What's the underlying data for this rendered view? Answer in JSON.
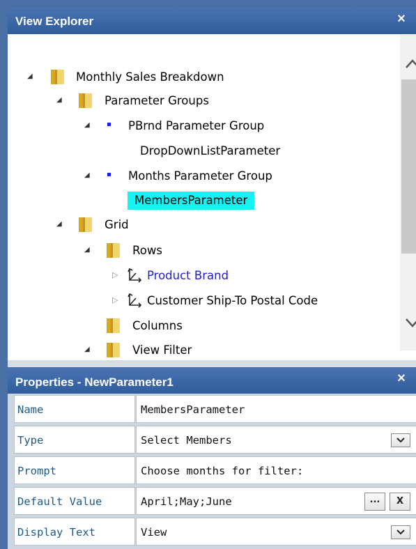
{
  "view_explorer": {
    "title": "View Explorer",
    "close": "×",
    "tree": {
      "root": "Monthly Sales Breakdown",
      "parameter_groups": "Parameter Groups",
      "pbrnd_group": "PBrnd Parameter Group",
      "dropdown_param": "DropDownListParameter",
      "months_group": "Months Parameter Group",
      "members_param": "MembersParameter",
      "grid": "Grid",
      "rows": "Rows",
      "product_brand": "Product Brand",
      "customer_postal": "Customer Ship-To Postal Code",
      "columns": "Columns",
      "view_filter": "View Filter"
    }
  },
  "properties": {
    "title": "Properties - NewParameter1",
    "close": "×",
    "rows": [
      {
        "name": "Name",
        "value": "MembersParameter"
      },
      {
        "name": "Type",
        "value": "Select Members"
      },
      {
        "name": "Prompt",
        "value": "Choose months for filter:"
      },
      {
        "name": "Default Value",
        "value": "April;May;June"
      },
      {
        "name": "Display Text",
        "value": "View"
      }
    ],
    "ellipsis_label": "...",
    "clear_label": "X"
  },
  "colors": {
    "titlebar": "#305d9c",
    "selection": "#16f2f2",
    "link": "#1c1cd8",
    "bullet": "#1d1df0"
  }
}
